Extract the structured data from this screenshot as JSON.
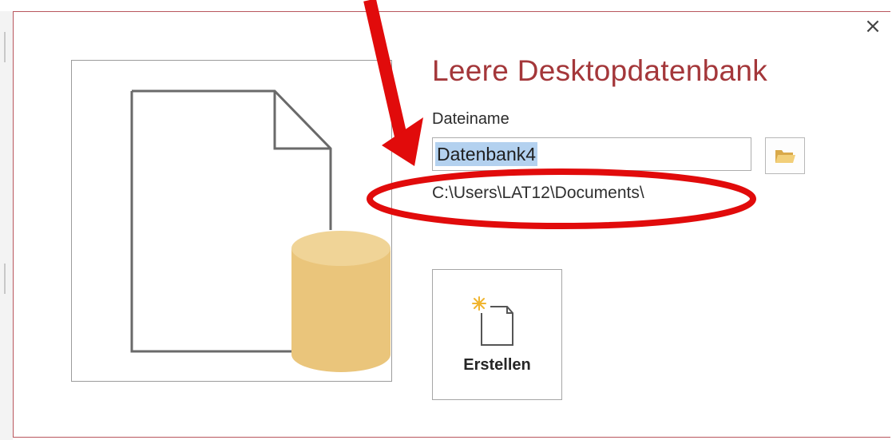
{
  "dialog": {
    "title": "Leere Desktopdatenbank",
    "close_label": "×"
  },
  "form": {
    "filename_label": "Dateiname",
    "filename_value": "Datenbank4",
    "path": "C:\\Users\\LAT12\\Documents\\"
  },
  "create_button": {
    "label": "Erstellen"
  },
  "icons": {
    "preview": "blank-database-document-icon",
    "browse": "folder-icon",
    "create": "new-document-sparkle-icon",
    "close": "close-icon"
  },
  "colors": {
    "title": "#a4373a",
    "dialog_border": "#b9565d",
    "selection": "#b3d1ef",
    "database": "#eac57b",
    "annotation": "#e10b0b"
  }
}
